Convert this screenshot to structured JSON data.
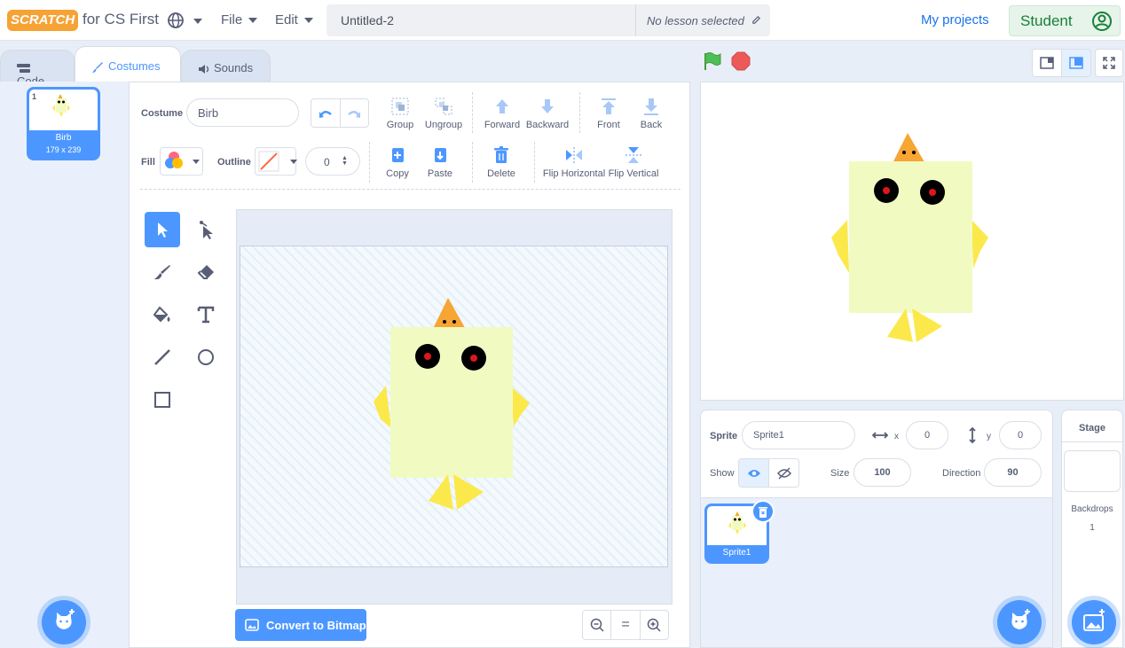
{
  "header": {
    "logo": "SCRATCH",
    "logo_sub": "for CS First",
    "menu_file": "File",
    "menu_edit": "Edit",
    "project_title": "Untitled-2",
    "lesson": "No lesson selected",
    "my_projects": "My projects",
    "user": "Student"
  },
  "tabs": {
    "code": "Code",
    "costumes": "Costumes",
    "sounds": "Sounds"
  },
  "costume_list": [
    {
      "index": "1",
      "name": "Birb",
      "size": "179 x 239"
    }
  ],
  "editor": {
    "costume_label": "Costume",
    "costume_name": "Birb",
    "fill_label": "Fill",
    "outline_label": "Outline",
    "outline_width": "0",
    "tools_row1": [
      "Group",
      "Ungroup",
      "Forward",
      "Backward",
      "Front",
      "Back"
    ],
    "tools_row2": [
      "Copy",
      "Paste",
      "Delete",
      "Flip Horizontal",
      "Flip Vertical"
    ],
    "convert_button": "Convert to Bitmap",
    "zoom_reset": "="
  },
  "sprite": {
    "sprite_label": "Sprite",
    "name": "Sprite1",
    "x_label": "x",
    "x": "0",
    "y_label": "y",
    "y": "0",
    "show_label": "Show",
    "size_label": "Size",
    "size": "100",
    "direction_label": "Direction",
    "direction": "90",
    "tile_name": "Sprite1"
  },
  "stage_pane": {
    "title": "Stage",
    "backdrops_label": "Backdrops",
    "backdrops_count": "1"
  },
  "colors": {
    "accent": "#4c97ff",
    "body": "#f1fbc1",
    "wing": "#fbe94b",
    "beak": "#f7a533",
    "eye_pupil": "#e0161d"
  }
}
